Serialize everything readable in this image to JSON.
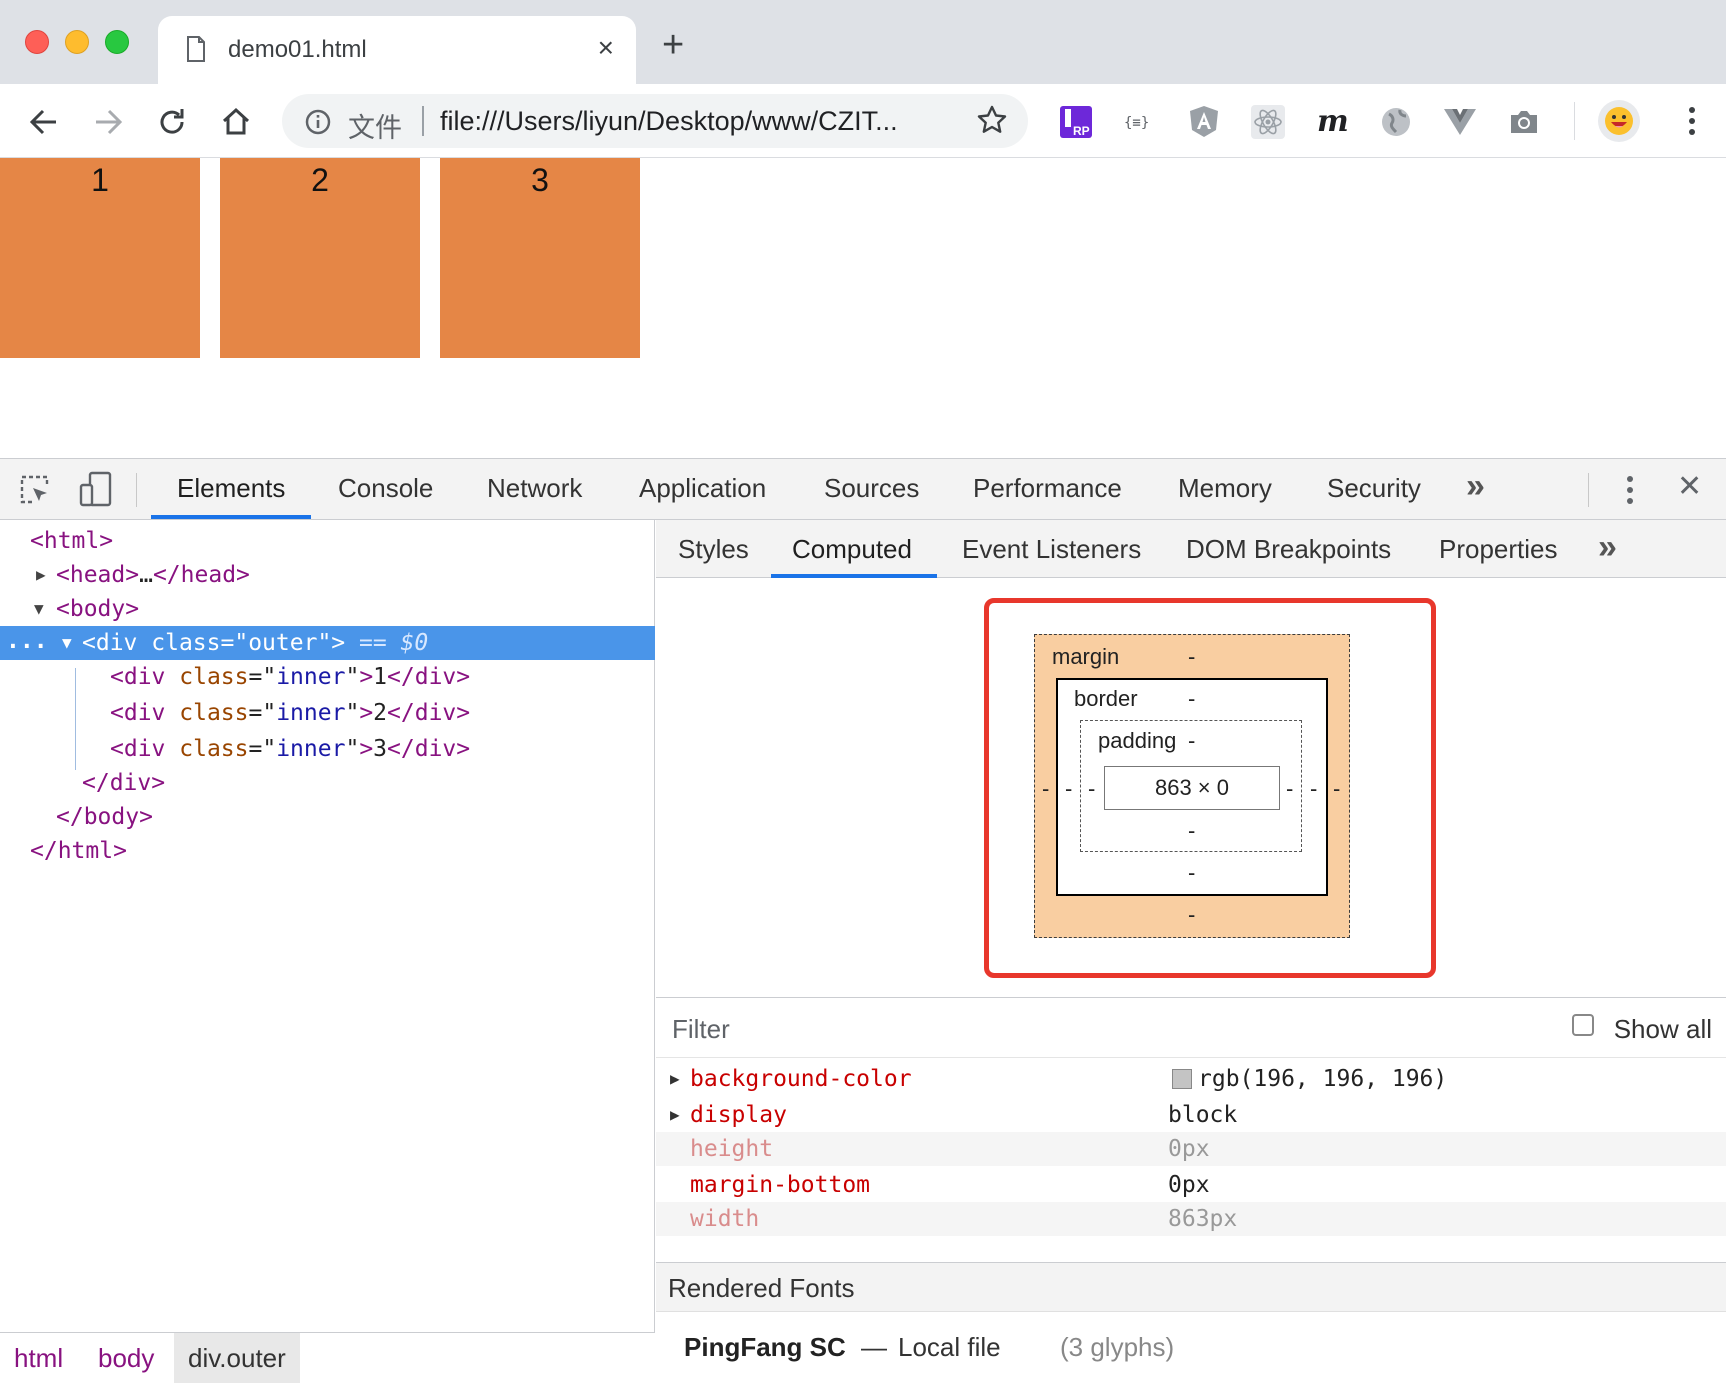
{
  "browser": {
    "tab_title": "demo01.html",
    "tab_close": "×",
    "new_tab": "+",
    "omnibox": {
      "scheme_label": "文件",
      "url": "file:///Users/liyun/Desktop/www/CZIT..."
    }
  },
  "page": {
    "boxes": [
      "1",
      "2",
      "3"
    ],
    "box_color": "#e58646"
  },
  "devtools": {
    "tabs": [
      "Elements",
      "Console",
      "Network",
      "Application",
      "Sources",
      "Performance",
      "Memory",
      "Security"
    ],
    "more": "»",
    "close": "✕",
    "dom": {
      "line1": "<html>",
      "line2_open": "<head>",
      "line2_ell": "…",
      "line2_close": "</head>",
      "line3": "<body>",
      "sel_dots": "...",
      "sel_tag_open": "<div ",
      "sel_attr_name": "class",
      "sel_eq": "=",
      "sel_attr_value": "\"outer\"",
      "sel_tag_end": ">",
      "sel_marker": " == $0",
      "children": [
        {
          "open": "<div ",
          "attr": "class",
          "val": "inner",
          "text": "1",
          "close": "</div>"
        },
        {
          "open": "<div ",
          "attr": "class",
          "val": "inner",
          "text": "2",
          "close": "</div>"
        },
        {
          "open": "<div ",
          "attr": "class",
          "val": "inner",
          "text": "3",
          "close": "</div>"
        }
      ],
      "close_div": "</div>",
      "close_body": "</body>",
      "close_html": "</html>"
    },
    "breadcrumbs": [
      "html",
      "body",
      "div.outer"
    ],
    "side_tabs": [
      "Styles",
      "Computed",
      "Event Listeners",
      "DOM Breakpoints",
      "Properties"
    ],
    "side_more": "»",
    "box_model": {
      "margin_label": "margin",
      "border_label": "border",
      "padding_label": "padding",
      "dash": "-",
      "content": "863 × 0"
    },
    "filter_placeholder": "Filter",
    "show_all": "Show all",
    "properties": [
      {
        "name": "background-color",
        "value": "rgb(196, 196, 196)",
        "expandable": true,
        "dim": false
      },
      {
        "name": "display",
        "value": "block",
        "expandable": true,
        "dim": false
      },
      {
        "name": "height",
        "value": "0px",
        "expandable": false,
        "dim": true
      },
      {
        "name": "margin-bottom",
        "value": "0px",
        "expandable": false,
        "dim": false
      },
      {
        "name": "width",
        "value": "863px",
        "expandable": false,
        "dim": true
      }
    ],
    "rendered_fonts_title": "Rendered Fonts",
    "font": {
      "name": "PingFang SC",
      "sep": "—",
      "source": "Local file",
      "glyphs": "(3 glyphs)"
    }
  }
}
